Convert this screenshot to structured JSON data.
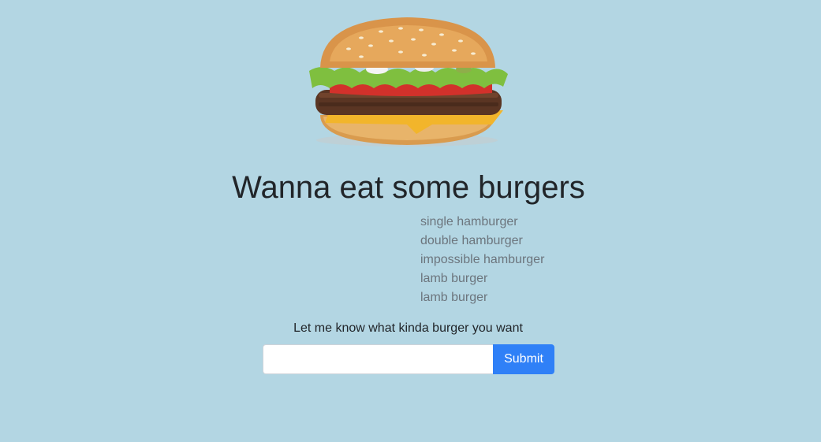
{
  "header": {
    "image": "hamburger-image",
    "title": "Wanna eat some burgers"
  },
  "menu": {
    "items": [
      "single hamburger",
      "double hamburger",
      "impossible hamburger",
      "lamb burger",
      "lamb burger"
    ]
  },
  "order_form": {
    "prompt": "Let me know what kinda burger you want",
    "input_value": "",
    "submit_label": "Submit"
  },
  "colors": {
    "background": "#b3d6e3",
    "button": "#2f80f7",
    "menu_text": "#6c757d"
  }
}
